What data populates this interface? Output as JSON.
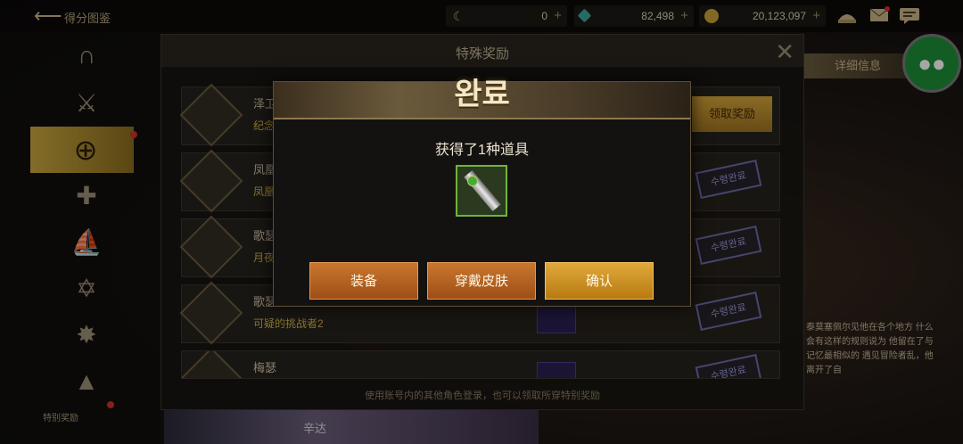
{
  "topbar": {
    "title": "得分图鉴",
    "currencies": [
      {
        "icon": "moon-icon",
        "value": "0"
      },
      {
        "icon": "crystal-icon",
        "value": "82,498"
      },
      {
        "icon": "gold-coin-icon",
        "value": "20,123,097"
      }
    ]
  },
  "leftnav": {
    "bottom_label": "特别奖励"
  },
  "panel": {
    "title": "特殊奖励",
    "rows": [
      {
        "title": "泽卫",
        "sub": "纪念",
        "action": "领取奖励"
      },
      {
        "title": "凤凰",
        "sub": "凤凰",
        "stamp": "수령완료"
      },
      {
        "title": "歌瑟",
        "sub": "月夜",
        "stamp": "수령완료"
      },
      {
        "title": "歌瑟",
        "sub": "可疑的挑战者2",
        "stamp": "수령완료"
      },
      {
        "title": "梅瑟",
        "sub": "",
        "stamp": "수령완료"
      }
    ],
    "footer": "使用账号内的其他角色登录，也可以领取所穿特别奖励"
  },
  "right": {
    "detail_label": "详细信息",
    "story_text": "泰莫塞佩尔见他在各个地方 什么会有这样的规则说为 他留在了与记忆最相似的 遇见冒险者乱，他离开了自"
  },
  "bottom_banner": {
    "label": "辛达"
  },
  "modal": {
    "title": "완료",
    "message": "获得了1种道具",
    "item_icon": "sword-icon",
    "buttons": {
      "equip": "装备",
      "wear_skin": "穿戴皮肤",
      "confirm": "确认"
    }
  },
  "colors": {
    "accent_gold": "#d4a43a",
    "button_orange": "#c9772f",
    "item_border_green": "#6fb33c"
  }
}
